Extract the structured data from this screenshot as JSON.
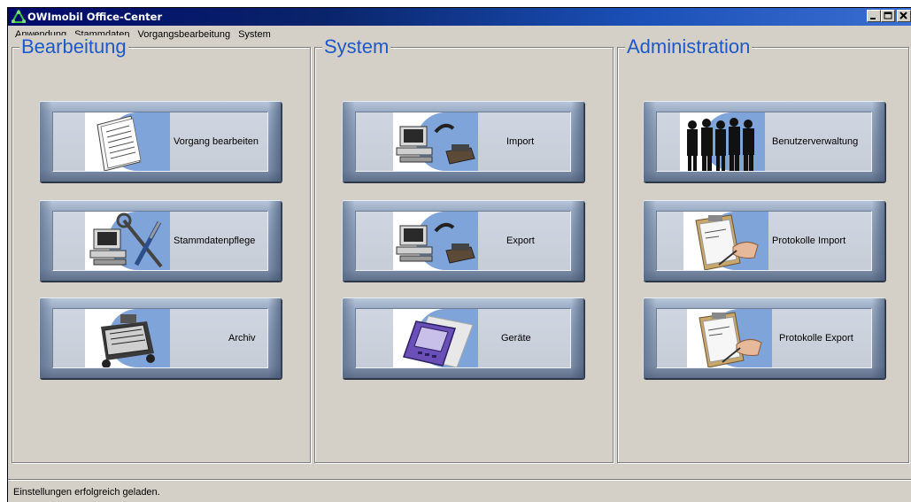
{
  "window": {
    "title": "OWImobil Office-Center",
    "minimize": "_",
    "maximize": "□",
    "close": "×"
  },
  "menu": {
    "items": [
      "Anwendung",
      "Stammdaten",
      "Vorgangsbearbeitung",
      "System"
    ]
  },
  "groups": {
    "bearbeitung": {
      "title": "Bearbeitung",
      "buttons": [
        {
          "label": "Vorgang bearbeiten",
          "icon": "document-icon"
        },
        {
          "label": "Stammdatenpflege",
          "icon": "computer-tools-icon"
        },
        {
          "label": "Archiv",
          "icon": "archive-cabinet-icon"
        }
      ]
    },
    "system": {
      "title": "System",
      "buttons": [
        {
          "label": "Import",
          "icon": "computer-phone-import-icon"
        },
        {
          "label": "Export",
          "icon": "computer-phone-export-icon"
        },
        {
          "label": "Geräte",
          "icon": "handheld-device-icon"
        }
      ]
    },
    "administration": {
      "title": "Administration",
      "buttons": [
        {
          "label": "Benutzerverwaltung",
          "icon": "people-silhouettes-icon"
        },
        {
          "label": "Protokolle Import",
          "icon": "clipboard-pen-icon"
        },
        {
          "label": "Protokolle Export",
          "icon": "clipboard-pen-icon"
        }
      ]
    }
  },
  "status": {
    "text": "Einstellungen erfolgreich geladen."
  },
  "colors": {
    "title_bar": "#0a246a",
    "group_title": "#1f58c8",
    "window_bg": "#d4d0c8",
    "icon_accent": "#7fa4da"
  }
}
